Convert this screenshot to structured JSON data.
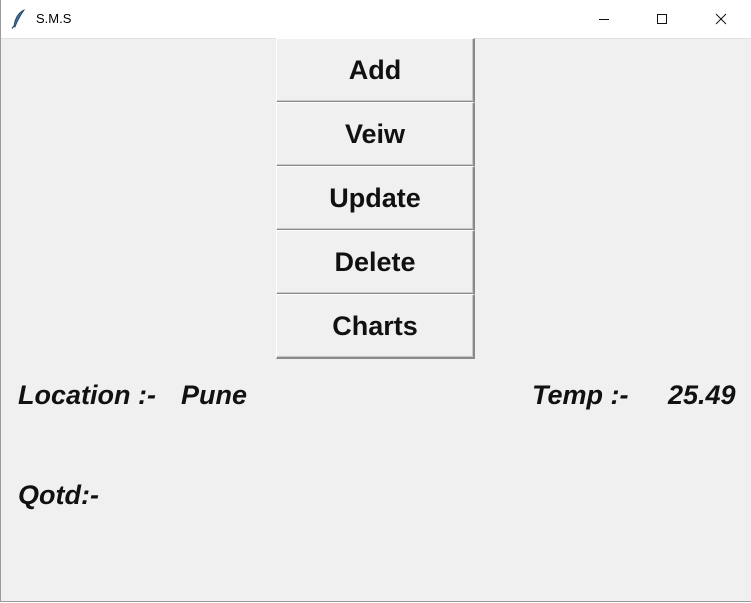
{
  "window": {
    "title": "S.M.S",
    "icon": "feather-icon",
    "controls": [
      "minimize-icon",
      "maximize-icon",
      "close-icon"
    ]
  },
  "menu": {
    "add_label": "Add",
    "view_label": "Veiw",
    "update_label": "Update",
    "delete_label": "Delete",
    "charts_label": "Charts"
  },
  "info": {
    "location_label": "Location :-",
    "location_value": "Pune",
    "temp_label": "Temp :-",
    "temp_value": "25.49",
    "qotd_label": "Qotd:-"
  },
  "colors": {
    "background": "#f0f0f0",
    "titlebar": "#ffffff",
    "text": "#111111"
  }
}
